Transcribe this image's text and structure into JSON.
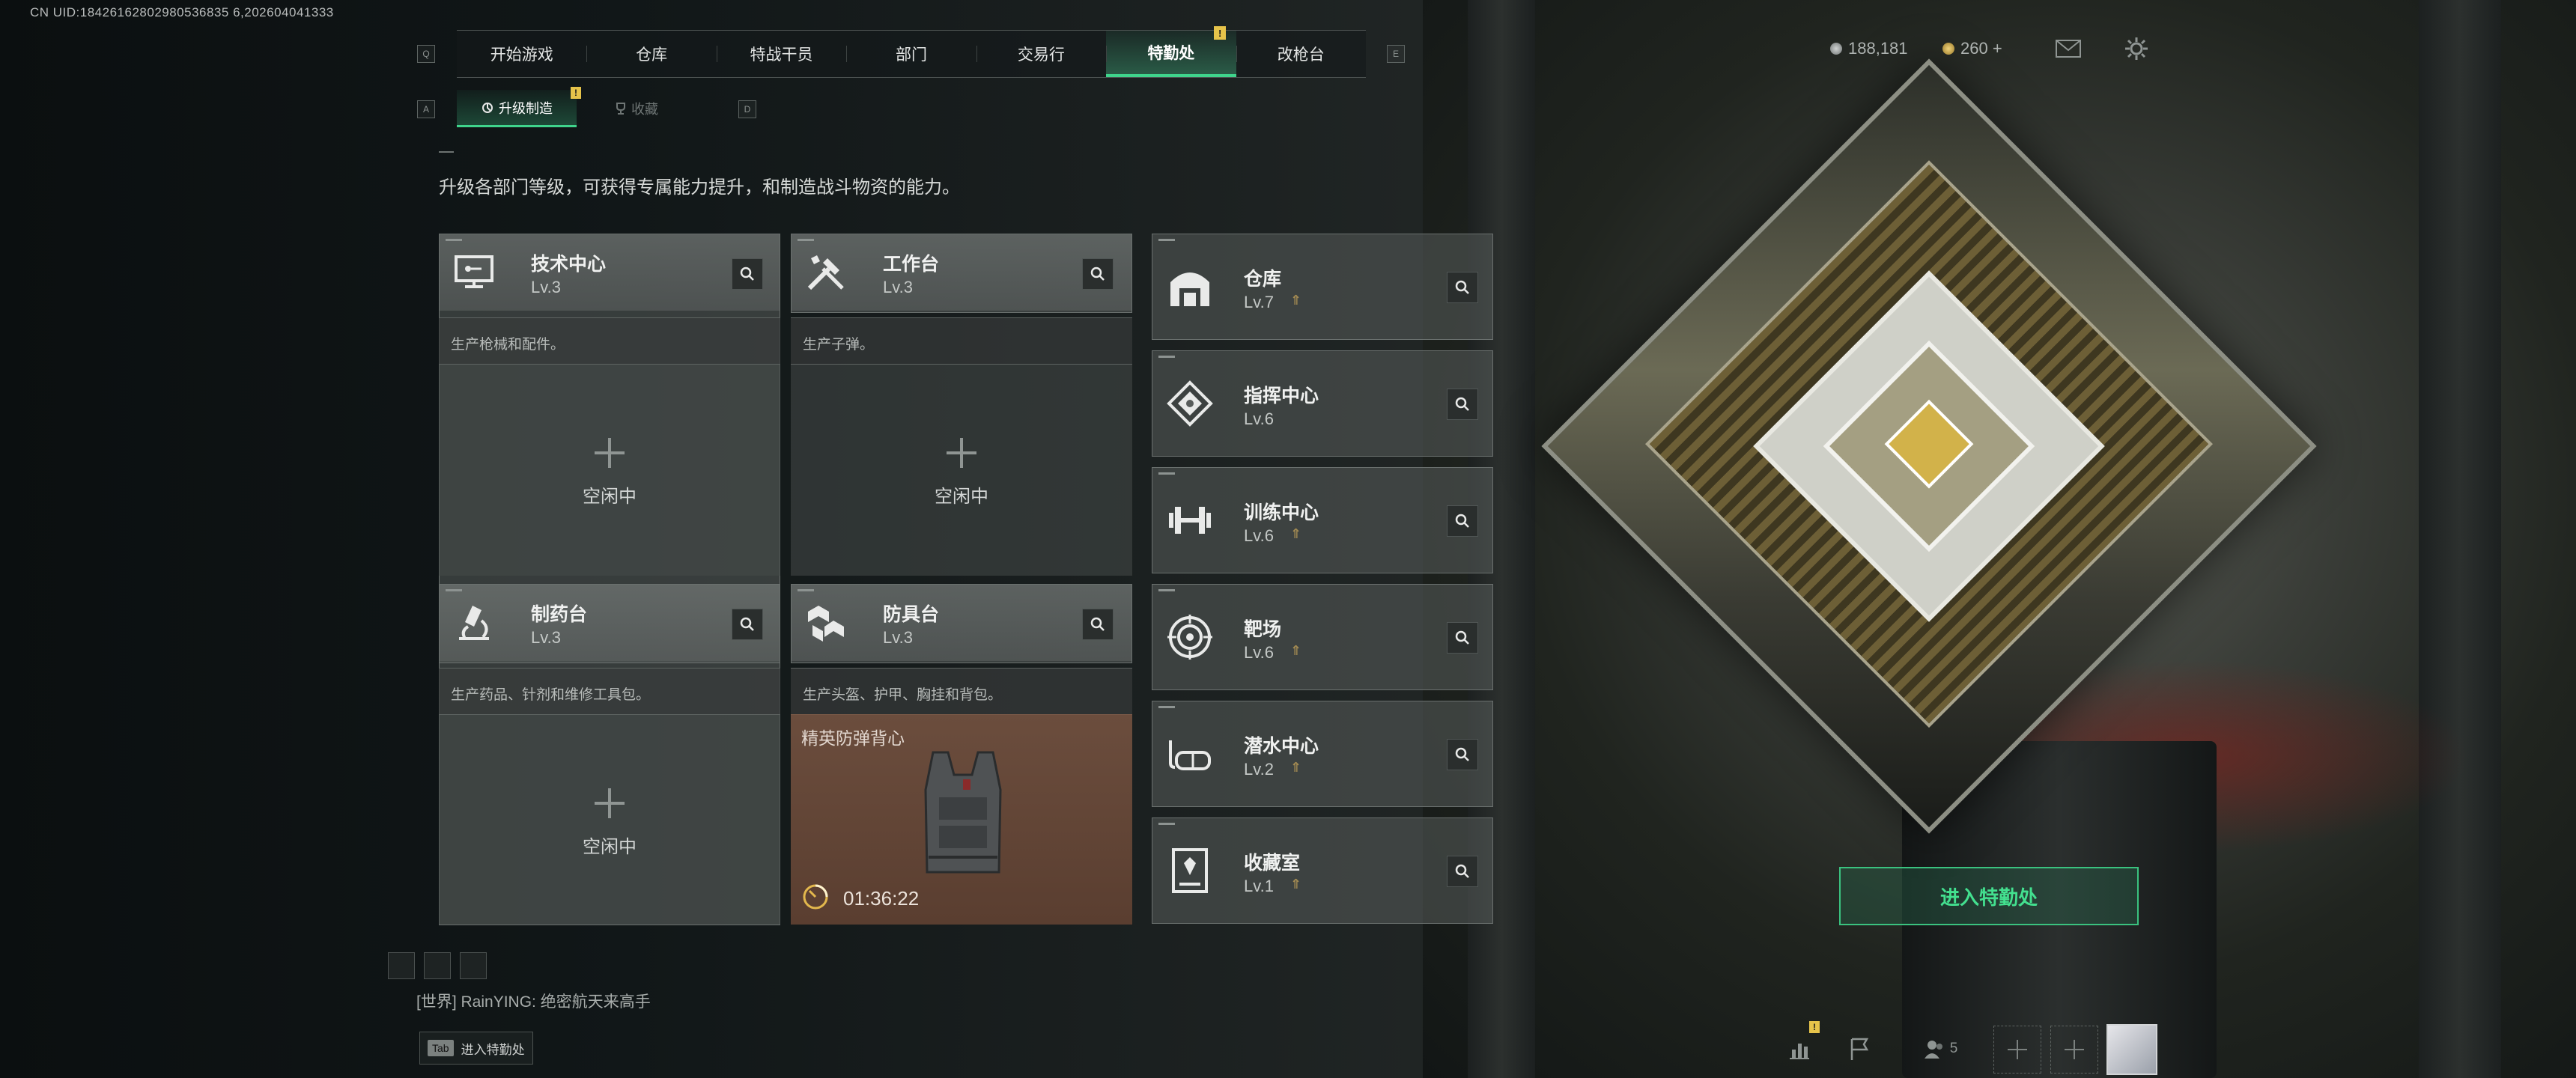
{
  "uid": "CN UID:18426162802980536835 6,202604041333",
  "main_tabs": {
    "key_left": "Q",
    "key_right": "E",
    "items": [
      {
        "label": "开始游戏"
      },
      {
        "label": "仓库"
      },
      {
        "label": "特战干员"
      },
      {
        "label": "部门"
      },
      {
        "label": "交易行"
      },
      {
        "label": "特勤处",
        "active": true,
        "badge": "!"
      },
      {
        "label": "改枪台"
      }
    ]
  },
  "sub_tabs": {
    "key_left": "A",
    "key_right": "D",
    "items": [
      {
        "label": "升级制造",
        "active": true,
        "badge": "!"
      },
      {
        "label": "收藏"
      }
    ]
  },
  "currency": {
    "silver": "188,181",
    "gold": "260 +"
  },
  "description": "升级各部门等级，可获得专属能力提升，和制造战斗物资的能力。",
  "production_cards": [
    {
      "title": "技术中心",
      "level": "Lv.3",
      "icon": "tech-center-icon",
      "subtitle": "生产枪械和配件。",
      "status": "空闲中"
    },
    {
      "title": "工作台",
      "level": "Lv.3",
      "icon": "workbench-icon",
      "subtitle": "生产子弹。",
      "status": "空闲中"
    },
    {
      "title": "制药台",
      "level": "Lv.3",
      "icon": "pharmacy-icon",
      "subtitle": "生产药品、针剂和维修工具包。",
      "status": "空闲中"
    },
    {
      "title": "防具台",
      "level": "Lv.3",
      "icon": "armor-bench-icon",
      "subtitle": "生产头盔、护甲、胸挂和背包。",
      "item_name": "精英防弹背心",
      "timer": "01:36:22"
    }
  ],
  "facility_cards": [
    {
      "title": "仓库",
      "level": "Lv.7",
      "icon": "warehouse-icon",
      "upgrade": true
    },
    {
      "title": "指挥中心",
      "level": "Lv.6",
      "icon": "command-center-icon",
      "upgrade": false
    },
    {
      "title": "训练中心",
      "level": "Lv.6",
      "icon": "dumbbell-icon",
      "upgrade": true
    },
    {
      "title": "靶场",
      "level": "Lv.6",
      "icon": "target-icon",
      "upgrade": true
    },
    {
      "title": "潜水中心",
      "level": "Lv.2",
      "icon": "diving-mask-icon",
      "upgrade": true
    },
    {
      "title": "收藏室",
      "level": "Lv.1",
      "icon": "collection-room-icon",
      "upgrade": true
    }
  ],
  "enter_button": "进入特勤处",
  "chat": {
    "channel": "[世界]",
    "user": "RainYING",
    "message": "绝密航天来高手"
  },
  "tab_hint": {
    "key": "Tab",
    "label": "进入特勤处"
  },
  "bottom_bar": {
    "friends_count": "5",
    "stats_badge": "!"
  },
  "colors": {
    "accent": "#3fd48c",
    "badge": "#e6c34a",
    "upgrade_arrow": "#a38a52"
  }
}
